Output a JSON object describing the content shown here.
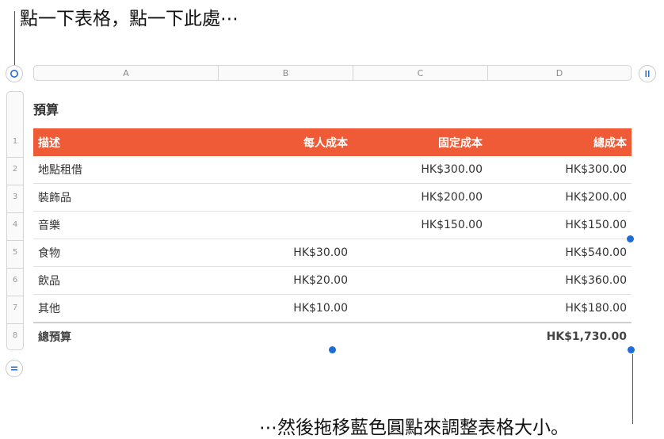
{
  "callouts": {
    "top": "點一下表格，點一下此處⋯",
    "bottom": "⋯然後拖移藍色圓點來調整表格大小。"
  },
  "column_headers": [
    "A",
    "B",
    "C",
    "D"
  ],
  "row_numbers": [
    "1",
    "2",
    "3",
    "4",
    "5",
    "6",
    "7",
    "8"
  ],
  "table": {
    "title": "預算",
    "header": [
      "描述",
      "每人成本",
      "固定成本",
      "總成本"
    ],
    "rows": [
      [
        "地點租借",
        "",
        "HK$300.00",
        "HK$300.00"
      ],
      [
        "裝飾品",
        "",
        "HK$200.00",
        "HK$200.00"
      ],
      [
        "音樂",
        "",
        "HK$150.00",
        "HK$150.00"
      ],
      [
        "食物",
        "HK$30.00",
        "",
        "HK$540.00"
      ],
      [
        "飲品",
        "HK$20.00",
        "",
        "HK$360.00"
      ],
      [
        "其他",
        "HK$10.00",
        "",
        "HK$180.00"
      ]
    ],
    "footer": [
      "總預算",
      "",
      "",
      "HK$1,730.00"
    ]
  },
  "colors": {
    "header_fill": "#ef5b36",
    "handle": "#1e6cd6",
    "control_icon": "#1e6cd6"
  },
  "icons": {
    "select_table": "circle-icon",
    "column_resize": "pause-bars-icon",
    "row_resize": "equals-bars-icon"
  }
}
